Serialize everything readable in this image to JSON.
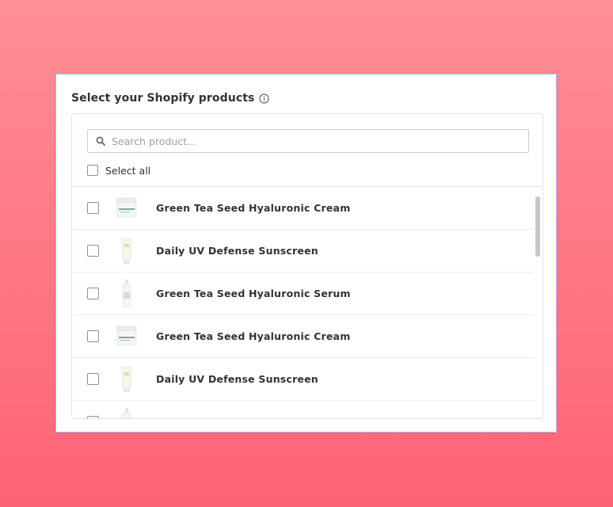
{
  "dialog": {
    "title": "Select your Shopify products",
    "info_icon": "info-circle-icon"
  },
  "search": {
    "icon": "search-icon",
    "placeholder": "Search product...",
    "value": ""
  },
  "select_all": {
    "label": "Select all",
    "checked": false
  },
  "products": [
    {
      "name": "Green Tea Seed Hyaluronic Cream",
      "thumbnail": "cream-jar-icon",
      "checked": false
    },
    {
      "name": "Daily UV Defense Sunscreen",
      "thumbnail": "sunscreen-tube-icon",
      "checked": false
    },
    {
      "name": "Green Tea Seed Hyaluronic Serum",
      "thumbnail": "serum-bottle-icon",
      "checked": false
    },
    {
      "name": "Green Tea Seed Hyaluronic Cream",
      "thumbnail": "cream-jar-icon",
      "checked": false
    },
    {
      "name": "Daily UV Defense Sunscreen",
      "thumbnail": "sunscreen-tube-icon",
      "checked": false
    },
    {
      "name": "",
      "thumbnail": "serum-bottle-icon",
      "checked": false
    }
  ],
  "colors": {
    "background_top": "#ff8f98",
    "background_bottom": "#ff6376",
    "card_border": "#aeb3da",
    "text": "#2f3337"
  }
}
